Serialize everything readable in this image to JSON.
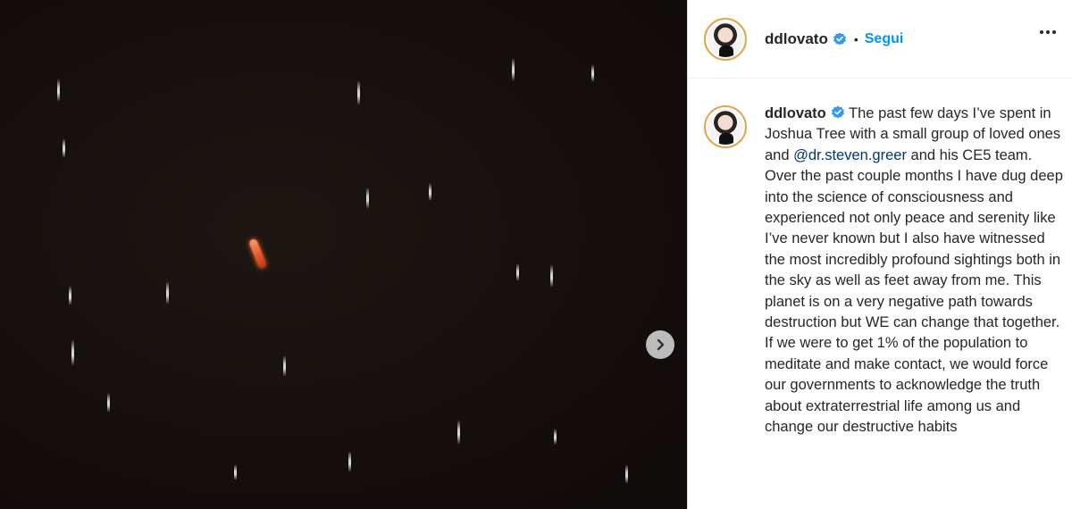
{
  "post": {
    "username": "ddlovato",
    "follow_label": "Segui",
    "separator": "•",
    "caption": {
      "part1": "The past few days I’ve spent in Joshua Tree with a small group of loved ones and ",
      "mention": "@dr.steven.greer",
      "part2": " and his CE5 team. Over the past couple months I have dug deep into the science of consciousness and experienced not only peace and serenity like I’ve never known but I also have witnessed the most incredibly profound sightings both in the sky as well as feet away from me. This planet is on a very negative path towards destruction but WE can change that together. If we were to get 1% of the population to meditate and make contact, we would force our governments to acknowledge the truth about extraterrestrial life among us and change our destructive habits"
    }
  },
  "colors": {
    "follow": "#0095f6",
    "verified": "#3897f0",
    "mention": "#00376b"
  },
  "icons": {
    "next": "chevron-right-icon",
    "more": "more-options-icon",
    "verified": "verified-badge-icon"
  }
}
